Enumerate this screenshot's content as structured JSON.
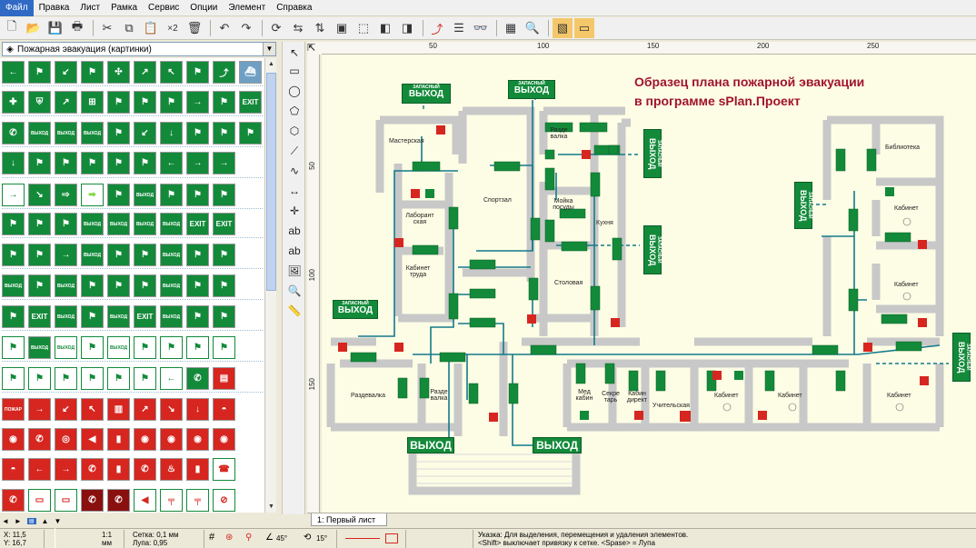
{
  "menu": [
    "Файл",
    "Правка",
    "Лист",
    "Рамка",
    "Сервис",
    "Опции",
    "Элемент",
    "Справка"
  ],
  "toolbar": {
    "multiply_label": "×2"
  },
  "library": {
    "selected": "Пожарная эвакуация (картинки)"
  },
  "ruler": {
    "h_ticks": [
      "50",
      "100",
      "150",
      "200",
      "250"
    ],
    "v_ticks": [
      "50",
      "100",
      "150"
    ]
  },
  "plan": {
    "title_line1": "Образец плана пожарной эвакуации",
    "title_line2": "в программе sPlan.Проект",
    "exit_big": "ВЫХОД",
    "exit_spare_top": "ЗАПАСНЫЙ",
    "exit_spare_bottom": "ВЫХОД",
    "rooms": {
      "workshop": "Мастерская",
      "lab": "Лаборант ская",
      "labor_room": "Кабинет труда",
      "gym": "Спортзал",
      "changing_top": "Разде валка",
      "dishwash": "Мойка посуды",
      "kitchen": "Кухня",
      "canteen": "Столовая",
      "library": "Библиотека",
      "cabinet": "Кабинет",
      "changing_bottom": "Раздевалка",
      "changing_small": "Разде валка",
      "med": "Мед кабин",
      "secretary": "Секре тарь",
      "director": "Кабин директ",
      "teachers": "Учительская"
    }
  },
  "tab": {
    "label": "1: Первый лист"
  },
  "status": {
    "x": "X: 11,5",
    "y": "Y: 16,7",
    "scale_top": "1:1",
    "scale_bottom": "мм",
    "grid": "Сетка: 0,1 мм",
    "zoom": "Лупа: 0,95",
    "angle1": "45°",
    "angle2": "15°",
    "hint1": "Указка: Для выделения, перемещения и удаления элементов.",
    "hint2": "<Shift> выключает привязку к сетке. <Spase> = Лупа"
  },
  "colors": {
    "sign_green": "#138a3a",
    "sign_red": "#d6261f",
    "title_red": "#a0142a",
    "wall_gray": "#c8c8c8",
    "route_teal": "#137a8a"
  }
}
